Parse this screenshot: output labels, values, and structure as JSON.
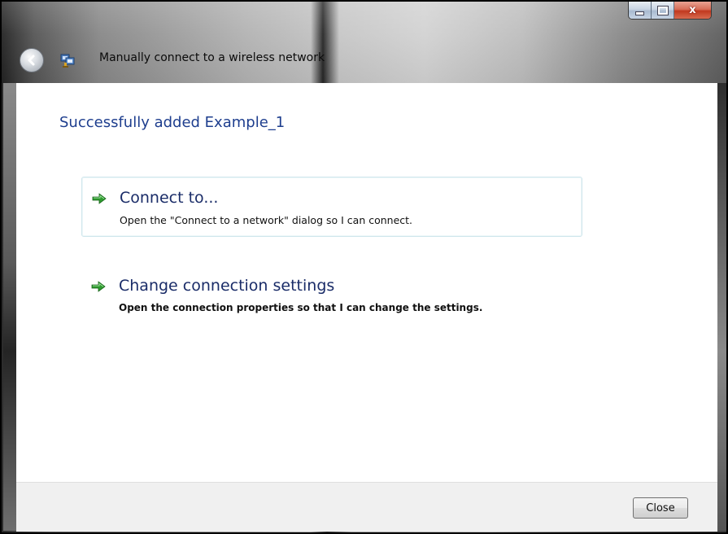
{
  "window": {
    "title": "Manually connect to a wireless network",
    "caption": {
      "minimize_glyph": "minimize-icon",
      "maximize_glyph": "maximize-icon",
      "close_glyph": "x"
    }
  },
  "content": {
    "heading": "Successfully added Example_1",
    "options": [
      {
        "title": "Connect to...",
        "description": "Open the \"Connect to a network\" dialog so I can connect.",
        "icon": "green-arrow-icon"
      },
      {
        "title": "Change connection settings",
        "description": "Open the connection properties so that I can change the settings.",
        "icon": "green-arrow-icon"
      }
    ]
  },
  "footer": {
    "close_label": "Close"
  },
  "colors": {
    "heading": "#1e3e8e",
    "option_title": "#1a2c68",
    "arrow": "#2f9b2f",
    "close_caption": "#c1391f"
  }
}
